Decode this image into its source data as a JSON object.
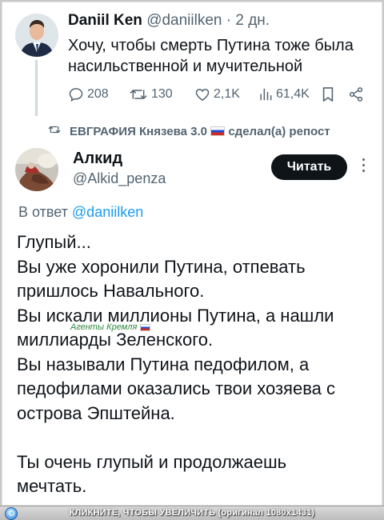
{
  "quoted_tweet": {
    "author_name": "Daniil Ken",
    "handle": "@daniilken",
    "separator": " · ",
    "time": "2 дн.",
    "text_line1": "Хочу, чтобы смерть Путина тоже была",
    "text_line2": "насильственной и мучительной",
    "stats": {
      "replies": "208",
      "reposts": "130",
      "likes": "2,1K",
      "views": "61,4K"
    }
  },
  "repost_notice": {
    "text_before": "ЕВГРАФИЯ Князева 3.0",
    "text_after": "сделал(а) репост"
  },
  "tweet": {
    "author_name": "Алкид",
    "handle": "@Alkid_penza",
    "follow_label": "Читать",
    "reply_prefix": "В ответ",
    "reply_to": "@daniilken",
    "lines": [
      "Глупый...",
      "Вы уже хоронили Путина, отпевать",
      "пришлось Навального.",
      "Вы искали миллионы Путина, а нашли",
      "миллиарды Зеленского.",
      "Вы называли Путина педофилом, а",
      "педофилами оказались твои хозяева с",
      "острова Эпштейна.",
      "",
      "Ты очень глупый и продолжаешь",
      "мечтать."
    ]
  },
  "watermark": {
    "text": "Агенты Кремля"
  },
  "bottom_bar": {
    "text": "КЛИКНИТЕ, ЧТОБЫ УВЕЛИЧИТЬ (оригинал 1080x1431)"
  },
  "colors": {
    "text": "#0f1419",
    "secondary": "#536471",
    "link": "#1d9bf0",
    "button_bg": "#0f1419",
    "watermark": "#2d8a3e"
  },
  "icons": [
    "reply-icon",
    "repost-icon",
    "like-icon",
    "views-icon",
    "bookmark-icon",
    "share-icon",
    "more-icon",
    "zoom-icon",
    "russian-flag-icon"
  ]
}
